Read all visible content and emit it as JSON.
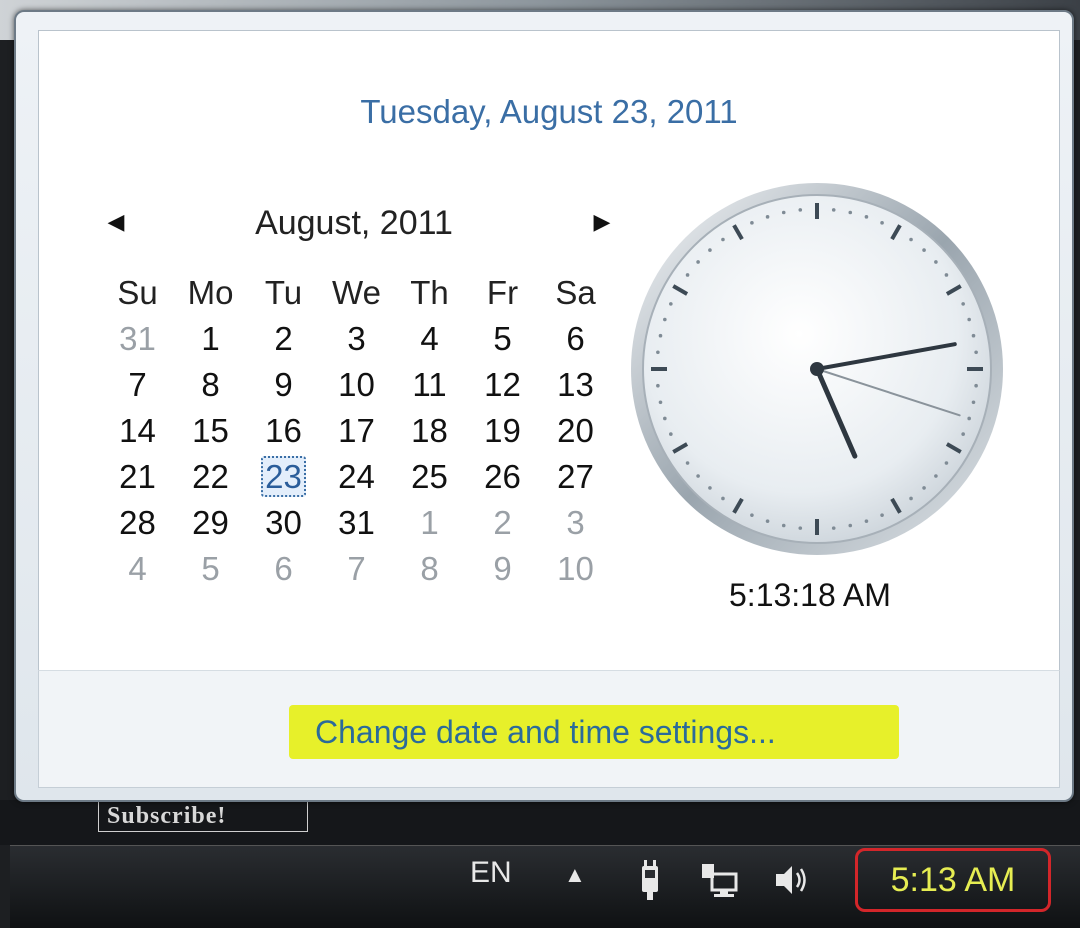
{
  "flyout": {
    "full_date": "Tuesday, August 23, 2011",
    "calendar": {
      "month_label": "August, 2011",
      "weekdays": [
        "Su",
        "Mo",
        "Tu",
        "We",
        "Th",
        "Fr",
        "Sa"
      ],
      "weeks": [
        [
          "31",
          "1",
          "2",
          "3",
          "4",
          "5",
          "6"
        ],
        [
          "7",
          "8",
          "9",
          "10",
          "11",
          "12",
          "13"
        ],
        [
          "14",
          "15",
          "16",
          "17",
          "18",
          "19",
          "20"
        ],
        [
          "21",
          "22",
          "23",
          "24",
          "25",
          "26",
          "27"
        ],
        [
          "28",
          "29",
          "30",
          "31",
          "1",
          "2",
          "3"
        ],
        [
          "4",
          "5",
          "6",
          "7",
          "8",
          "9",
          "10"
        ]
      ],
      "selected_day": "23"
    },
    "clock_time": "5:13:18 AM",
    "change_settings_link": "Change date and time settings..."
  },
  "background": {
    "subscribe_label": "Subscribe!"
  },
  "taskbar": {
    "language": "EN",
    "show_hidden_icons": "▲",
    "clock": "5:13 AM",
    "highlight_color": "#d3262a"
  }
}
